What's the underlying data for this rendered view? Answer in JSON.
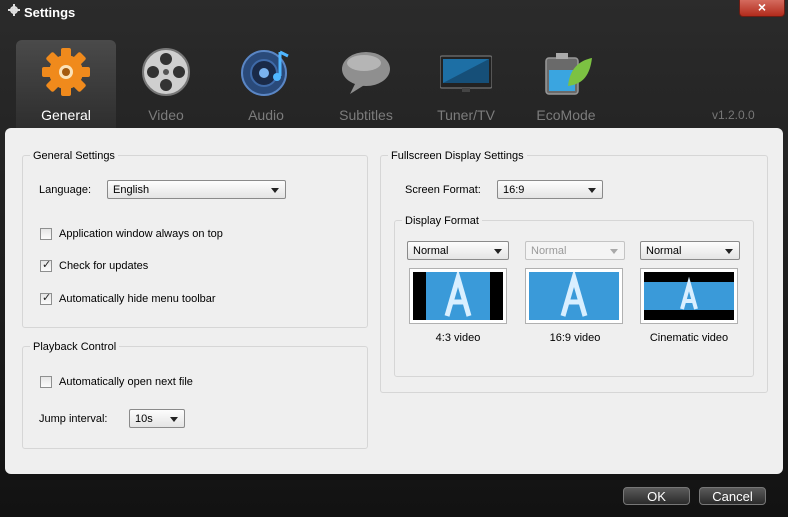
{
  "window": {
    "title": "Settings"
  },
  "tabs": [
    {
      "label": "General",
      "icon": "gear-icon",
      "active": true
    },
    {
      "label": "Video",
      "icon": "film-reel-icon"
    },
    {
      "label": "Audio",
      "icon": "speaker-music-icon"
    },
    {
      "label": "Subtitles",
      "icon": "speech-bubble-icon"
    },
    {
      "label": "Tuner/TV",
      "icon": "tv-monitor-icon"
    },
    {
      "label": "EcoMode",
      "icon": "battery-leaf-icon"
    }
  ],
  "version": "v1.2.0.0",
  "general_settings": {
    "title": "General Settings",
    "language_label": "Language:",
    "language_value": "English",
    "checkboxes": [
      {
        "label": "Application window always on top",
        "checked": false
      },
      {
        "label": "Check for updates",
        "checked": true
      },
      {
        "label": "Automatically hide menu toolbar",
        "checked": true
      }
    ]
  },
  "playback": {
    "title": "Playback Control",
    "auto_next_label": "Automatically open next file",
    "auto_next_checked": false,
    "jump_label": "Jump interval:",
    "jump_value": "10s"
  },
  "fullscreen": {
    "title": "Fullscreen Display Settings",
    "screen_format_label": "Screen Format:",
    "screen_format_value": "16:9",
    "display_format_title": "Display Format",
    "formats": [
      {
        "mode": "Normal",
        "caption": "4:3 video",
        "enabled": true
      },
      {
        "mode": "Normal",
        "caption": "16:9 video",
        "enabled": false
      },
      {
        "mode": "Normal",
        "caption": "Cinematic video",
        "enabled": true
      }
    ]
  },
  "buttons": {
    "ok": "OK",
    "cancel": "Cancel"
  },
  "colors": {
    "accent_blue": "#3a9ad9",
    "panel_bg": "#efefef",
    "close_red": "#c0392b"
  }
}
